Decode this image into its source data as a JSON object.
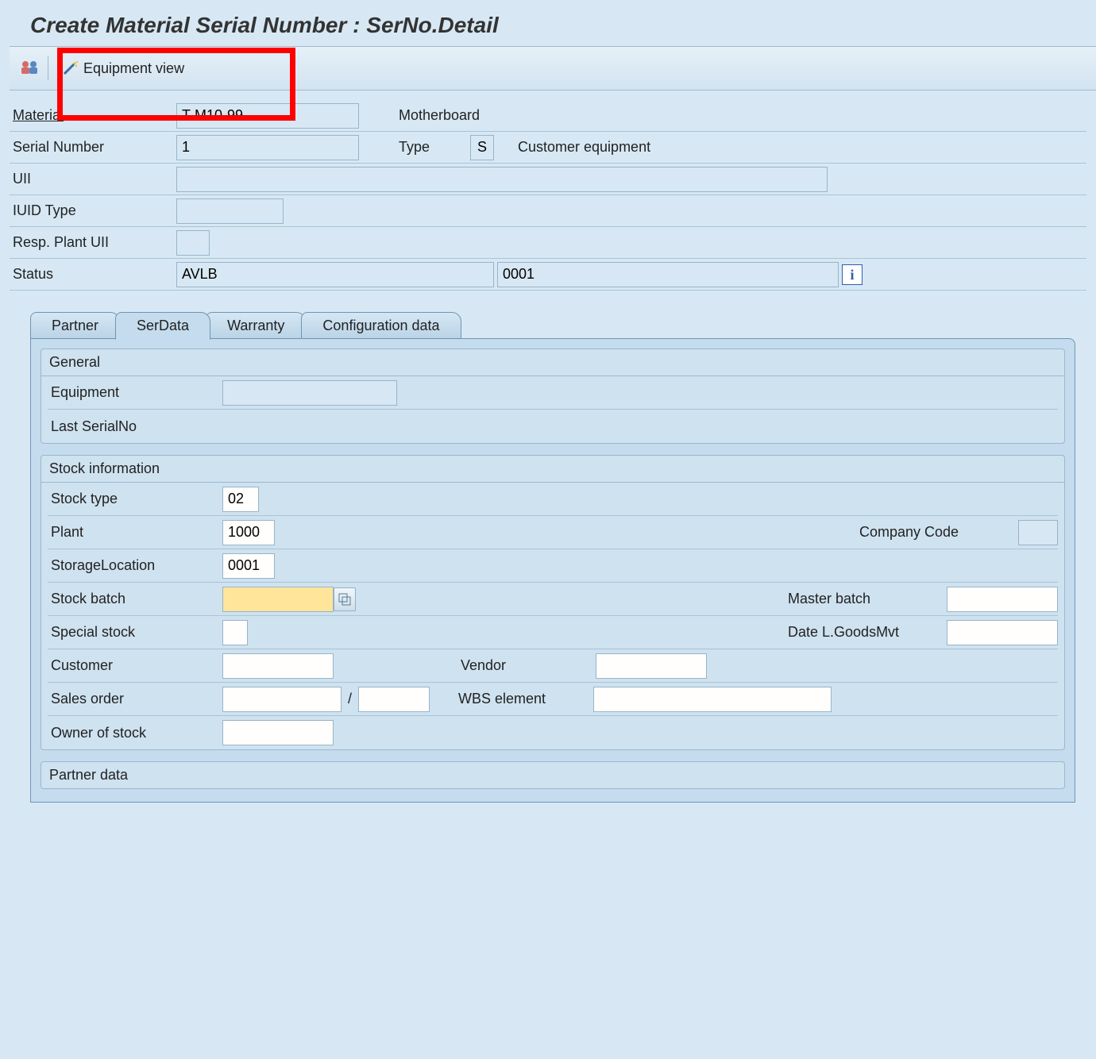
{
  "page_title": "Create Material Serial Number : SerNo.Detail",
  "toolbar": {
    "equipment_view_label": "Equipment view"
  },
  "header": {
    "material_label": "Material",
    "material_value": "T-M10-99",
    "material_desc": "Motherboard",
    "serial_label": "Serial Number",
    "serial_value": "1",
    "type_label": "Type",
    "type_value": "S",
    "type_desc": "Customer equipment",
    "uii_label": "UII",
    "uii_value": "",
    "iuid_type_label": "IUID Type",
    "iuid_type_value": "",
    "resp_plant_label": "Resp. Plant UII",
    "resp_plant_value": "",
    "status_label": "Status",
    "status_value": "AVLB",
    "status_code": "0001"
  },
  "tabs": {
    "partner": "Partner",
    "serdata": "SerData",
    "warranty": "Warranty",
    "config": "Configuration data"
  },
  "general": {
    "title": "General",
    "equipment_label": "Equipment",
    "equipment_value": "",
    "last_serial_label": "Last SerialNo"
  },
  "stock": {
    "title": "Stock information",
    "stock_type_label": "Stock type",
    "stock_type_value": "02",
    "plant_label": "Plant",
    "plant_value": "1000",
    "company_code_label": "Company Code",
    "company_code_value": "",
    "storage_loc_label": "StorageLocation",
    "storage_loc_value": "0001",
    "stock_batch_label": "Stock batch",
    "stock_batch_value": "",
    "master_batch_label": "Master batch",
    "master_batch_value": "",
    "special_stock_label": "Special stock",
    "special_stock_value": "",
    "date_goodsmvt_label": "Date L.GoodsMvt",
    "date_goodsmvt_value": "",
    "customer_label": "Customer",
    "customer_value": "",
    "vendor_label": "Vendor",
    "vendor_value": "",
    "sales_order_label": "Sales order",
    "sales_order_value": "",
    "sales_order_item": "",
    "wbs_label": "WBS element",
    "wbs_value": "",
    "owner_label": "Owner of stock",
    "owner_value": ""
  },
  "partner_data": {
    "title": "Partner data"
  }
}
